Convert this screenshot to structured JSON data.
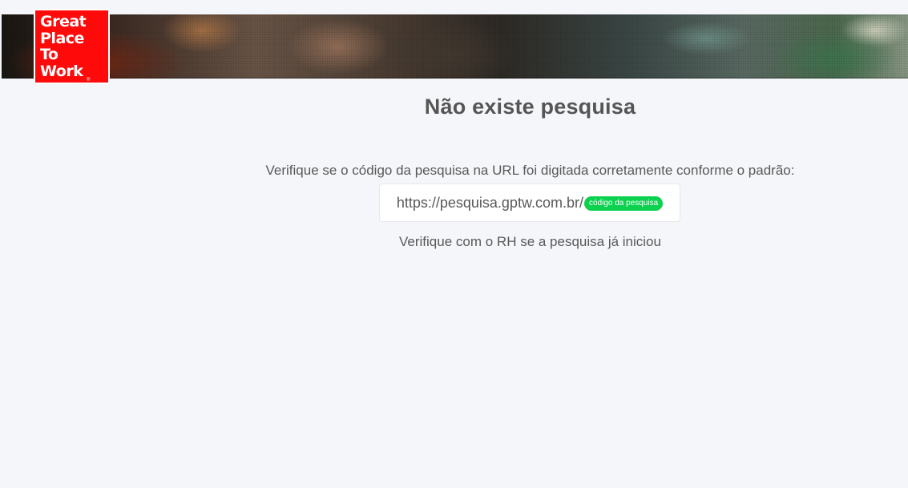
{
  "logo": {
    "lines": [
      "Great",
      "Place",
      "To",
      "Work"
    ],
    "registered": "®"
  },
  "main": {
    "title": "Não existe pesquisa",
    "instruction": "Verifique se o código da pesquisa na URL foi digitada corretamente conforme o padrão:",
    "url_base": "https://pesquisa.gptw.com.br/",
    "url_code_badge": "código da pesquisa",
    "hint": "Verifique com o RH se a pesquisa já iniciou"
  },
  "colors": {
    "background": "#f5f6fa",
    "logo_red": "#ff0a0a",
    "badge_green": "#0bd14e",
    "text": "#595959",
    "title": "#555555"
  }
}
